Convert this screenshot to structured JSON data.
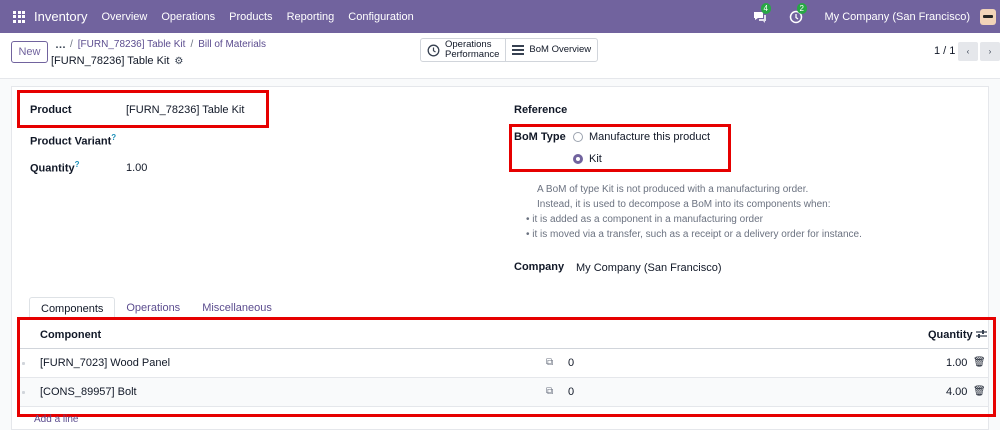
{
  "navbar": {
    "app_name": "Inventory",
    "menu": [
      "Overview",
      "Operations",
      "Products",
      "Reporting",
      "Configuration"
    ],
    "messages_count": "4",
    "activities_count": "2",
    "company": "My Company (San Francisco)"
  },
  "control": {
    "new_label": "New",
    "ellipsis": "…",
    "breadcrumbs": [
      "[FURN_78236] Table Kit",
      "Bill of Materials"
    ],
    "separator": "/",
    "record_title": "[FURN_78236] Table Kit",
    "smart_buttons": {
      "operations_performance_line1": "Operations",
      "operations_performance_line2": "Performance",
      "bom_overview": "BoM Overview"
    },
    "pager": "1 / 1"
  },
  "form": {
    "product_label": "Product",
    "product_value": "[FURN_78236] Table Kit",
    "variant_label": "Product Variant",
    "quantity_label": "Quantity",
    "quantity_value": "1.00",
    "help_mark": "?",
    "reference_label": "Reference",
    "bom_type_label": "BoM Type",
    "bom_type_options": [
      "Manufacture this product",
      "Kit"
    ],
    "bom_type_selected": "Kit",
    "kit_note_line1": "A BoM of type Kit is not produced with a manufacturing order.",
    "kit_note_line2": "Instead, it is used to decompose a BoM into its components when:",
    "kit_note_bullets": [
      "it is added as a component in a manufacturing order",
      "it is moved via a transfer, such as a receipt or a delivery order for instance."
    ],
    "company_label": "Company",
    "company_value": "My Company (San Francisco)"
  },
  "notebook": {
    "tabs": [
      "Components",
      "Operations",
      "Miscellaneous"
    ],
    "active_tab": "Components",
    "columns": [
      "Component",
      "Quantity"
    ],
    "rows": [
      {
        "component": "[FURN_7023] Wood Panel",
        "forecast": "0",
        "quantity": "1.00"
      },
      {
        "component": "[CONS_89957] Bolt",
        "forecast": "0",
        "quantity": "4.00"
      }
    ],
    "add_line": "Add a line"
  },
  "colors": {
    "brand": "#71639e",
    "highlight": "#e60000",
    "link": "#5c4d8f"
  }
}
